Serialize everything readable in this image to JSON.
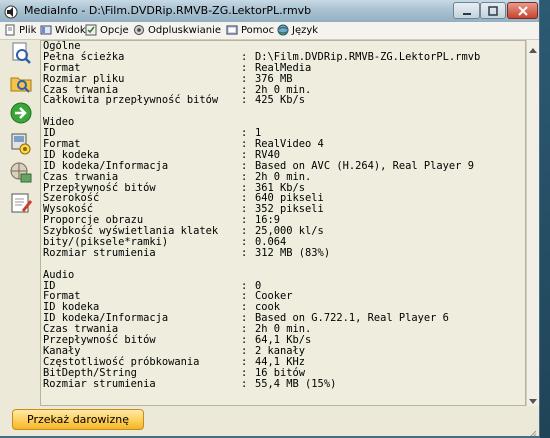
{
  "window": {
    "title": "MediaInfo - D:\\Film.DVDRip.RMVB-ZG.LektorPL.rmvb"
  },
  "menu": [
    {
      "label": "Plik",
      "icon": "file-icon"
    },
    {
      "label": "Widok",
      "icon": "view-icon"
    },
    {
      "label": "Opcje",
      "icon": "options-icon"
    },
    {
      "label": "Odpluskwianie",
      "icon": "debug-icon"
    },
    {
      "label": "Pomoc",
      "icon": "help-icon"
    },
    {
      "label": "Język",
      "icon": "language-icon"
    }
  ],
  "sidebar": [
    {
      "name": "open-file-icon"
    },
    {
      "name": "open-folder-icon"
    },
    {
      "name": "next-arrow-icon"
    },
    {
      "name": "export-icon"
    },
    {
      "name": "knowledge-base-icon"
    },
    {
      "name": "preferences-icon"
    }
  ],
  "info": {
    "general": {
      "title": "Ogólne",
      "rows": [
        {
          "key": "Pełna ścieżka",
          "value": "D:\\Film.DVDRip.RMVB-ZG.LektorPL.rmvb"
        },
        {
          "key": "Format",
          "value": "RealMedia"
        },
        {
          "key": "Rozmiar pliku",
          "value": "376 MB"
        },
        {
          "key": "Czas trwania",
          "value": "2h 0 min."
        },
        {
          "key": "Całkowita przepływność bitów",
          "value": "425 Kb/s"
        }
      ]
    },
    "video": {
      "title": "Wideo",
      "rows": [
        {
          "key": "ID",
          "value": "1"
        },
        {
          "key": "Format",
          "value": "RealVideo 4"
        },
        {
          "key": "ID kodeka",
          "value": "RV40"
        },
        {
          "key": "ID kodeka/Informacja",
          "value": "Based on AVC (H.264), Real Player 9"
        },
        {
          "key": "Czas trwania",
          "value": "2h 0 min."
        },
        {
          "key": "Przepływność bitów",
          "value": "361 Kb/s"
        },
        {
          "key": "Szerokość",
          "value": "640 pikseli"
        },
        {
          "key": "Wysokość",
          "value": "352 pikseli"
        },
        {
          "key": "Proporcje obrazu",
          "value": "16:9"
        },
        {
          "key": "Szybkość wyświetlania klatek",
          "value": "25,000 kl/s"
        },
        {
          "key": "bity/(piksele*ramki)",
          "value": "0.064"
        },
        {
          "key": "Rozmiar strumienia",
          "value": "312 MB (83%)"
        }
      ]
    },
    "audio": {
      "title": "Audio",
      "rows": [
        {
          "key": "ID",
          "value": "0"
        },
        {
          "key": "Format",
          "value": "Cooker"
        },
        {
          "key": "ID kodeka",
          "value": "cook"
        },
        {
          "key": "ID kodeka/Informacja",
          "value": "Based on G.722.1, Real Player 6"
        },
        {
          "key": "Czas trwania",
          "value": "2h 0 min."
        },
        {
          "key": "Przepływność bitów",
          "value": "64,1 Kb/s"
        },
        {
          "key": "Kanały",
          "value": "2 kanały"
        },
        {
          "key": "Częstotliwość próbkowania",
          "value": "44,1 KHz"
        },
        {
          "key": "BitDepth/String",
          "value": "16 bitów"
        },
        {
          "key": "Rozmiar strumienia",
          "value": "55,4 MB (15%)"
        }
      ]
    }
  },
  "status": {
    "donate_label": "Przekaż darowiznę"
  },
  "colors": {
    "donate_bg": "#ffcf5a",
    "content_bg": "#efedde",
    "window_bg": "#ece9d8"
  }
}
